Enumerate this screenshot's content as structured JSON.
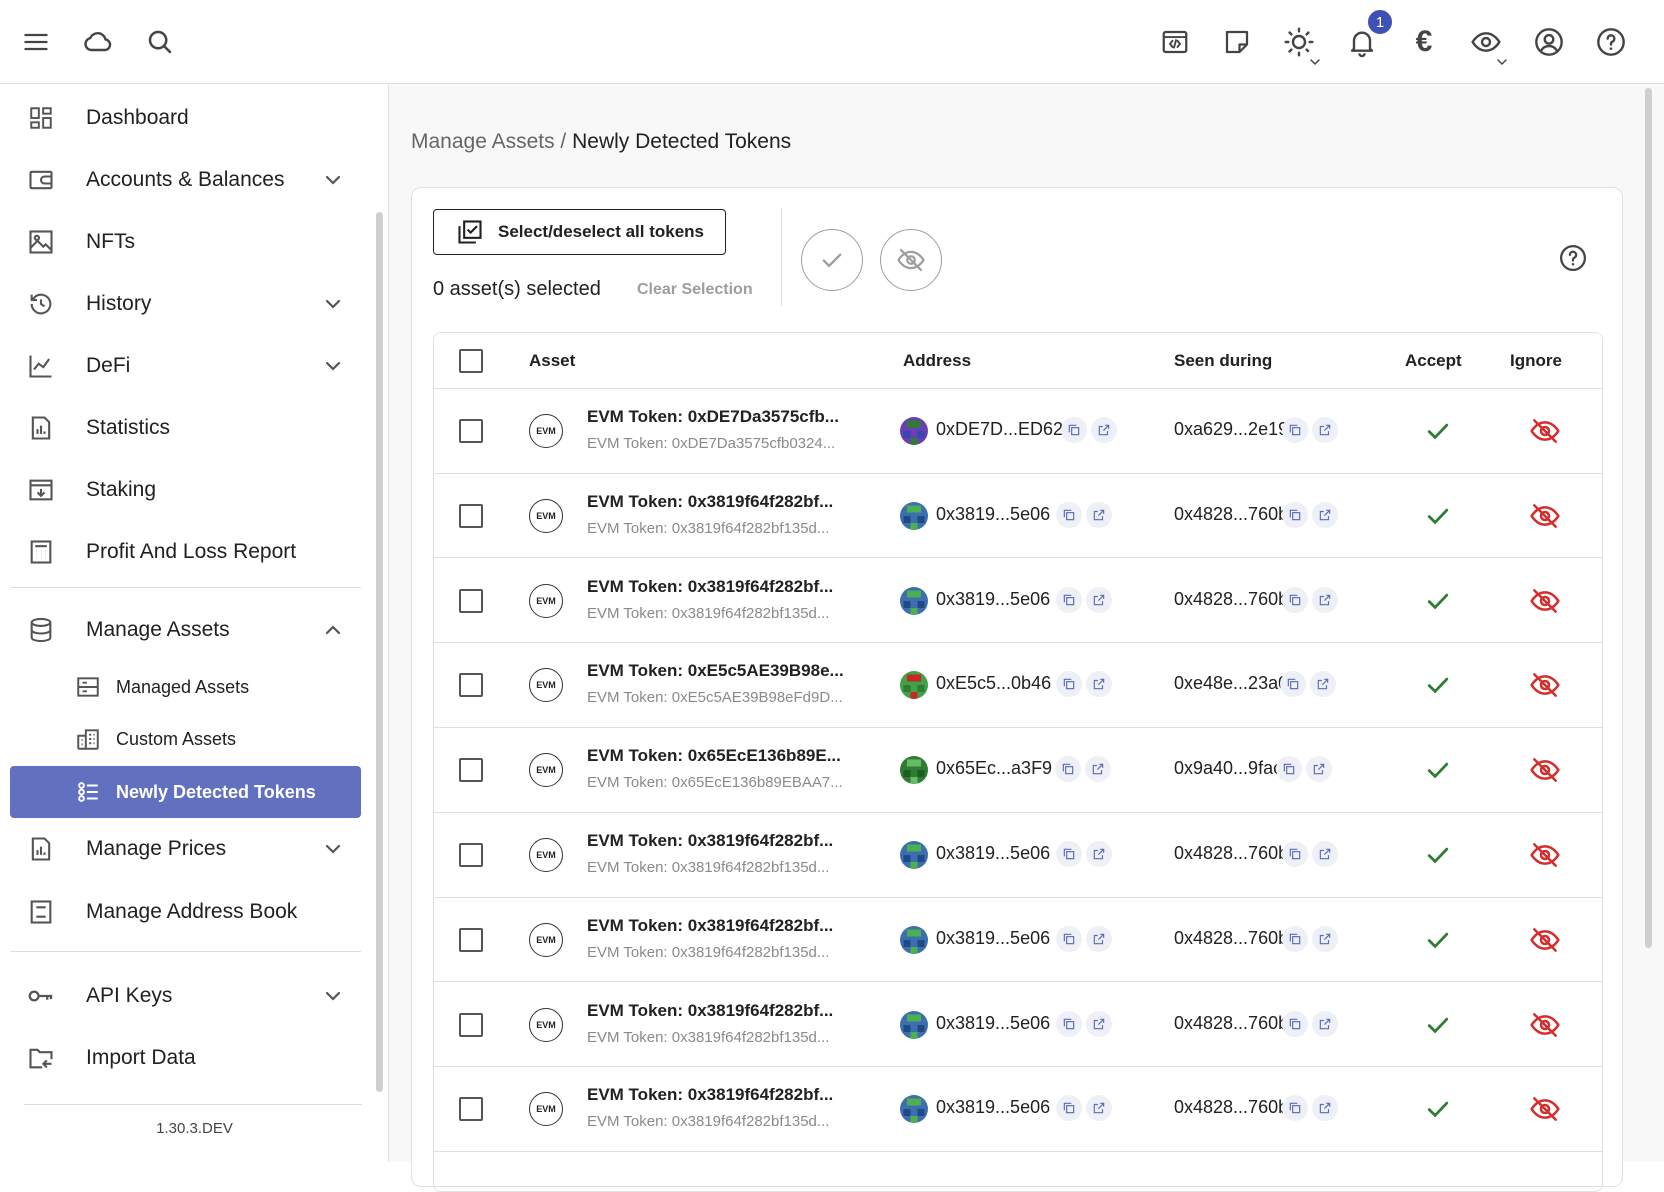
{
  "topbar": {
    "notification_count": "1",
    "currency_symbol": "€"
  },
  "sidebar": {
    "items": [
      {
        "label": "Dashboard"
      },
      {
        "label": "Accounts & Balances"
      },
      {
        "label": "NFTs"
      },
      {
        "label": "History"
      },
      {
        "label": "DeFi"
      },
      {
        "label": "Statistics"
      },
      {
        "label": "Staking"
      },
      {
        "label": "Profit And Loss Report"
      },
      {
        "label": "Manage Assets"
      },
      {
        "label": "Managed Assets"
      },
      {
        "label": "Custom Assets"
      },
      {
        "label": "Newly Detected Tokens"
      },
      {
        "label": "Manage Prices"
      },
      {
        "label": "Manage Address Book"
      },
      {
        "label": "API Keys"
      },
      {
        "label": "Import Data"
      }
    ],
    "version": "1.30.3.DEV",
    "accent_color": "#6270c0"
  },
  "breadcrumb": {
    "parent": "Manage Assets",
    "separator": " / ",
    "current": "Newly Detected Tokens"
  },
  "toolbar": {
    "select_all_label": "Select/deselect all tokens",
    "selected_count": "0 asset(s) selected",
    "clear_selection_label": "Clear Selection"
  },
  "table": {
    "columns": {
      "asset": "Asset",
      "address": "Address",
      "seen_during": "Seen during",
      "accept": "Accept",
      "ignore": "Ignore"
    },
    "evm_badge": "EVM",
    "rows": [
      {
        "name": "EVM Token: 0xDE7Da3575cfb...",
        "sub": "EVM Token: 0xDE7Da3575cfb0324...",
        "address": "0xDE7D...ED62",
        "seen": "0xa629...2e19",
        "avatar": "purple"
      },
      {
        "name": "EVM Token: 0x3819f64f282bf...",
        "sub": "EVM Token: 0x3819f64f282bf135d...",
        "address": "0x3819...5e06",
        "seen": "0x4828...760b",
        "avatar": "blue"
      },
      {
        "name": "EVM Token: 0x3819f64f282bf...",
        "sub": "EVM Token: 0x3819f64f282bf135d...",
        "address": "0x3819...5e06",
        "seen": "0x4828...760b",
        "avatar": "blue"
      },
      {
        "name": "EVM Token: 0xE5c5AE39B98e...",
        "sub": "EVM Token: 0xE5c5AE39B98eFd9D...",
        "address": "0xE5c5...0b46",
        "seen": "0xe48e...23a0",
        "avatar": "green-red"
      },
      {
        "name": "EVM Token: 0x65EcE136b89E...",
        "sub": "EVM Token: 0x65EcE136b89EBAA7...",
        "address": "0x65Ec...a3F9",
        "seen": "0x9a40...9fac",
        "avatar": "green"
      },
      {
        "name": "EVM Token: 0x3819f64f282bf...",
        "sub": "EVM Token: 0x3819f64f282bf135d...",
        "address": "0x3819...5e06",
        "seen": "0x4828...760b",
        "avatar": "blue"
      },
      {
        "name": "EVM Token: 0x3819f64f282bf...",
        "sub": "EVM Token: 0x3819f64f282bf135d...",
        "address": "0x3819...5e06",
        "seen": "0x4828...760b",
        "avatar": "blue"
      },
      {
        "name": "EVM Token: 0x3819f64f282bf...",
        "sub": "EVM Token: 0x3819f64f282bf135d...",
        "address": "0x3819...5e06",
        "seen": "0x4828...760b",
        "avatar": "blue"
      },
      {
        "name": "EVM Token: 0x3819f64f282bf...",
        "sub": "EVM Token: 0x3819f64f282bf135d...",
        "address": "0x3819...5e06",
        "seen": "0x4828...760b",
        "avatar": "blue"
      }
    ],
    "accept_color": "#2e7d32",
    "ignore_color": "#d32f2f"
  }
}
